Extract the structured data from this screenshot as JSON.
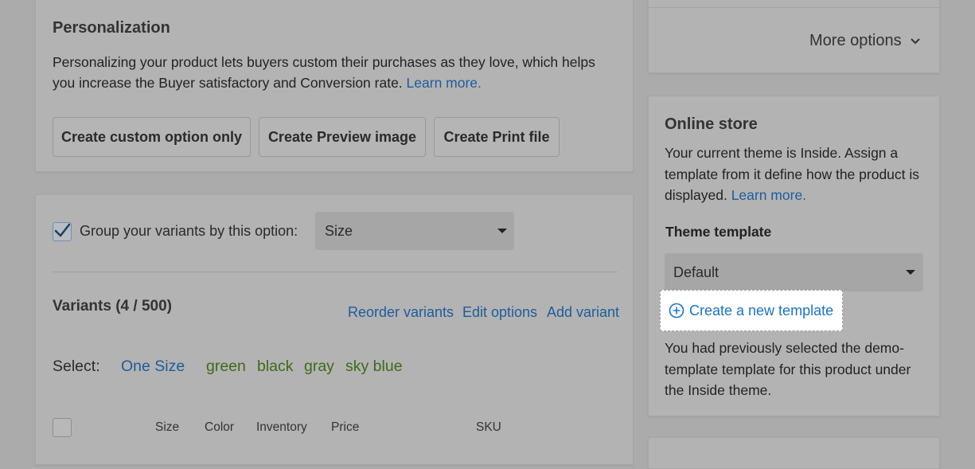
{
  "personalization": {
    "title": "Personalization",
    "desc_line1": "Personalizing your product lets buyers custom their purchases as they love, which helps",
    "desc_line2": "you increase the Buyer satisfactory and Conversion rate.",
    "learn_more": "Learn more.",
    "buttons": [
      {
        "label": "Create custom option only"
      },
      {
        "label": "Create Preview image"
      },
      {
        "label": "Create Print file"
      }
    ]
  },
  "variants_card": {
    "group_label": "Group your variants by this option:",
    "group_checked": true,
    "group_select_value": "Size",
    "title": "Variants (4 / 500)",
    "actions": [
      {
        "label": "Reorder variants"
      },
      {
        "label": "Edit options"
      },
      {
        "label": "Add variant"
      }
    ],
    "select_label": "Select:",
    "select_options": [
      "One Size",
      "green",
      "black",
      "gray",
      "sky blue"
    ],
    "table_headers": [
      "Size",
      "Color",
      "Inventory",
      "Price",
      "SKU"
    ]
  },
  "more_options": {
    "label": "More options"
  },
  "online_store": {
    "title": "Online store",
    "desc_line1": "Your current theme is Inside. Assign a",
    "desc_line2": "template from it define how the product is",
    "desc_line3": "displayed.",
    "learn_more": "Learn more.",
    "theme_template_label": "Theme template",
    "theme_template_value": "Default",
    "create_template": "Create a new template",
    "note_line1": "You had previously selected the demo-",
    "note_line2": "template template for this product under",
    "note_line3": "the Inside theme."
  },
  "colors": {
    "overlay_bg": "#ababab",
    "link": "#1e5c9c",
    "highlight_link": "#1a73c8",
    "variant_color_text": "#3f6a1a"
  }
}
